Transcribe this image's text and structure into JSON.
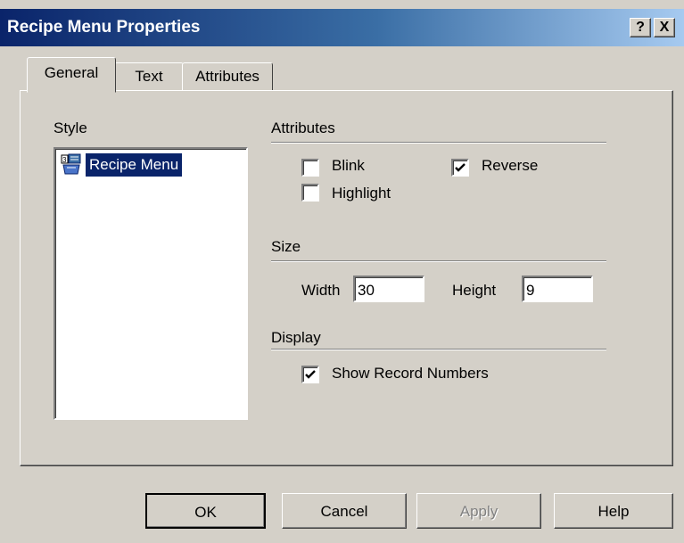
{
  "window": {
    "title": "Recipe Menu Properties"
  },
  "titlebar_buttons": {
    "help": "?",
    "close": "X"
  },
  "tabs": [
    {
      "label": "General",
      "active": true
    },
    {
      "label": "Text",
      "active": false
    },
    {
      "label": "Attributes",
      "active": false
    }
  ],
  "style_group": {
    "label": "Style",
    "items": [
      {
        "label": "Recipe Menu",
        "icon": "recipe-menu-icon",
        "selected": true
      }
    ]
  },
  "attributes_group": {
    "label": "Attributes",
    "checkboxes": [
      {
        "label": "Blink",
        "checked": false
      },
      {
        "label": "Reverse",
        "checked": true
      },
      {
        "label": "Highlight",
        "checked": false
      }
    ]
  },
  "size_group": {
    "label": "Size",
    "width_label": "Width",
    "width_value": "30",
    "height_label": "Height",
    "height_value": "9"
  },
  "display_group": {
    "label": "Display",
    "checkboxes": [
      {
        "label": "Show Record Numbers",
        "checked": true
      }
    ]
  },
  "buttons": {
    "ok": "OK",
    "cancel": "Cancel",
    "apply": "Apply",
    "help": "Help"
  },
  "colors": {
    "face": "#d4d0c8",
    "title_start": "#0a246a",
    "title_end": "#a6caf0",
    "selection": "#0a246a"
  }
}
